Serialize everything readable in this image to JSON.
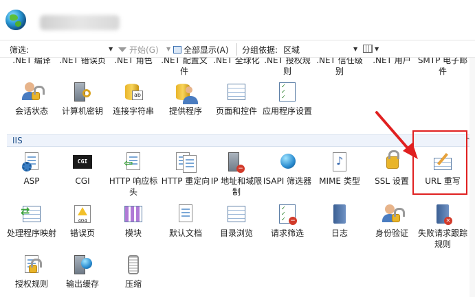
{
  "toolbar": {
    "filter_label": "筛选:",
    "start_label": "开始(G)",
    "show_all_label": "全部显示(A)",
    "group_by_label": "分组依据:",
    "group_value": "区域"
  },
  "top_row": [
    {
      "label": ".NET 编译",
      "icon": "dotnet-compile-icon"
    },
    {
      "label": ".NET 错误页",
      "icon": "dotnet-error-page-icon"
    },
    {
      "label": ".NET 角色",
      "icon": "dotnet-roles-icon"
    },
    {
      "label": ".NET 配置文件",
      "icon": "dotnet-profile-icon"
    },
    {
      "label": ".NET 全球化",
      "icon": "dotnet-globalization-icon"
    },
    {
      "label": ".NET 授权规则",
      "icon": "dotnet-authorization-icon"
    },
    {
      "label": ".NET 信任级别",
      "icon": "dotnet-trust-level-icon"
    },
    {
      "label": ".NET 用户",
      "icon": "dotnet-users-icon"
    },
    {
      "label": "SMTP 电子邮件",
      "icon": "smtp-email-icon"
    }
  ],
  "aspnet_row2": [
    {
      "label": "会话状态",
      "icon": "session-state-icon"
    },
    {
      "label": "计算机密钥",
      "icon": "machine-key-icon"
    },
    {
      "label": "连接字符串",
      "icon": "connection-strings-icon"
    },
    {
      "label": "提供程序",
      "icon": "providers-icon"
    },
    {
      "label": "页面和控件",
      "icon": "pages-controls-icon"
    },
    {
      "label": "应用程序设置",
      "icon": "app-settings-icon"
    }
  ],
  "section": {
    "title": "IIS"
  },
  "iis_row1": [
    {
      "label": "ASP",
      "icon": "asp-icon"
    },
    {
      "label": "CGI",
      "icon": "cgi-icon"
    },
    {
      "label": "HTTP 响应标头",
      "icon": "http-response-headers-icon"
    },
    {
      "label": "HTTP 重定向",
      "icon": "http-redirect-icon"
    },
    {
      "label": "IP 地址和域限制",
      "icon": "ip-domain-restrictions-icon"
    },
    {
      "label": "ISAPI 筛选器",
      "icon": "isapi-filters-icon"
    },
    {
      "label": "MIME 类型",
      "icon": "mime-types-icon"
    },
    {
      "label": "SSL 设置",
      "icon": "ssl-settings-icon"
    },
    {
      "label": "URL 重写",
      "icon": "url-rewrite-icon"
    }
  ],
  "iis_row2": [
    {
      "label": "处理程序映射",
      "icon": "handler-mappings-icon"
    },
    {
      "label": "错误页",
      "icon": "error-pages-icon"
    },
    {
      "label": "模块",
      "icon": "modules-icon"
    },
    {
      "label": "默认文档",
      "icon": "default-document-icon"
    },
    {
      "label": "目录浏览",
      "icon": "directory-browsing-icon"
    },
    {
      "label": "请求筛选",
      "icon": "request-filtering-icon"
    },
    {
      "label": "日志",
      "icon": "logging-icon"
    },
    {
      "label": "身份验证",
      "icon": "authentication-icon"
    },
    {
      "label": "失败请求跟踪规则",
      "icon": "failed-request-tracing-icon"
    }
  ],
  "iis_row3": [
    {
      "label": "授权规则",
      "icon": "authorization-rules-icon"
    },
    {
      "label": "输出缓存",
      "icon": "output-caching-icon"
    },
    {
      "label": "压缩",
      "icon": "compression-icon"
    }
  ],
  "error_page_badge": "404",
  "cgi_badge": "CGI",
  "ab_badge": "ab",
  "colors": {
    "highlight": "#e02020",
    "section_bg": "#eef3fb"
  }
}
